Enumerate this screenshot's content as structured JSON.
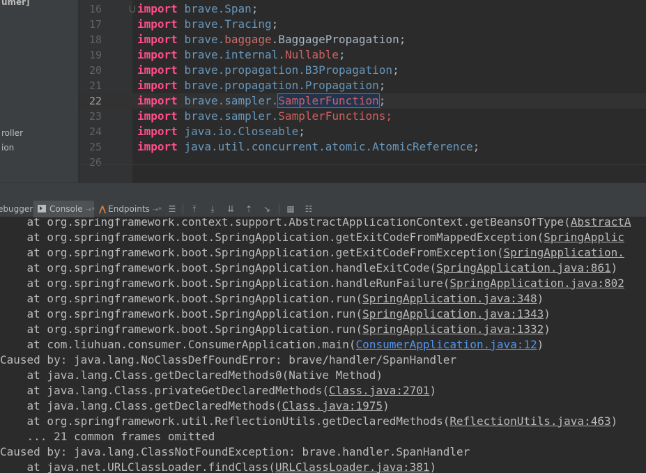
{
  "project_tree": {
    "items": [
      {
        "label": "umer]",
        "bold": true
      },
      {
        "label": "roller",
        "bold": false
      },
      {
        "label": "ion",
        "bold": false
      }
    ]
  },
  "editor": {
    "current_line": "22",
    "lines": [
      {
        "no": "16",
        "kw": "import",
        "parts": [
          {
            "t": "brave.",
            "c": "pkg"
          },
          {
            "t": "Span",
            "c": "pkg"
          },
          {
            "t": ";",
            "c": "cls"
          }
        ]
      },
      {
        "no": "17",
        "kw": "import",
        "parts": [
          {
            "t": "brave.",
            "c": "pkg"
          },
          {
            "t": "Tracing",
            "c": "pkg"
          },
          {
            "t": ";",
            "c": "cls"
          }
        ]
      },
      {
        "no": "18",
        "kw": "import",
        "parts": [
          {
            "t": "brave.",
            "c": "pkg"
          },
          {
            "t": "baggage",
            "c": "dep"
          },
          {
            "t": ".BaggagePropagation;",
            "c": "cls"
          }
        ]
      },
      {
        "no": "19",
        "kw": "import",
        "parts": [
          {
            "t": "brave.internal.",
            "c": "pkg"
          },
          {
            "t": "Nullable",
            "c": "err"
          },
          {
            "t": ";",
            "c": "cls"
          }
        ]
      },
      {
        "no": "20",
        "kw": "import",
        "parts": [
          {
            "t": "brave.propagation.B3Propagation",
            "c": "pkg"
          },
          {
            "t": ";",
            "c": "cls"
          }
        ]
      },
      {
        "no": "21",
        "kw": "import",
        "parts": [
          {
            "t": "brave.propagation.Propagation",
            "c": "pkg"
          },
          {
            "t": ";",
            "c": "cls"
          }
        ]
      },
      {
        "no": "22",
        "kw": "import",
        "parts": [
          {
            "t": "brave.sampler.",
            "c": "pkg"
          },
          {
            "t": "SamplerFunction",
            "c": "err hl"
          },
          {
            "t": ";",
            "c": "cls"
          }
        ]
      },
      {
        "no": "23",
        "kw": "import",
        "parts": [
          {
            "t": "brave.sampler.",
            "c": "pkg"
          },
          {
            "t": "SamplerFunctions",
            "c": "err"
          },
          {
            "t": ";",
            "c": "err"
          }
        ]
      },
      {
        "no": "24",
        "kw": "import",
        "parts": [
          {
            "t": "java.io.Closeable",
            "c": "pkg"
          },
          {
            "t": ";",
            "c": "cls"
          }
        ]
      },
      {
        "no": "25",
        "kw": "import",
        "parts": [
          {
            "t": "java.util.concurrent.atomic.AtomicReference",
            "c": "pkg"
          },
          {
            "t": ";",
            "c": "cls"
          }
        ]
      },
      {
        "no": "26",
        "kw": "",
        "parts": []
      }
    ]
  },
  "toolbar": {
    "debugger_label": "ebugger",
    "console_label": "Console",
    "console_pin": "→*",
    "endpoints_label": "Endpoints",
    "endpoints_pin": "→*",
    "icons": [
      "menu-icon",
      "scroll-up-icon",
      "download-icon",
      "download-all-icon",
      "upload-icon",
      "step-out-icon",
      "table-icon",
      "settings-columns-icon"
    ]
  },
  "console": {
    "lines": [
      {
        "pre": "    at org.springframework.context.support.AbstractApplicationContext.getBeansOfType(",
        "link": "AbstractA",
        "post": ""
      },
      {
        "pre": "    at org.springframework.boot.SpringApplication.getExitCodeFromMappedException(",
        "link": "SpringApplic",
        "post": ""
      },
      {
        "pre": "    at org.springframework.boot.SpringApplication.getExitCodeFromException(",
        "link": "SpringApplication.",
        "post": ""
      },
      {
        "pre": "    at org.springframework.boot.SpringApplication.handleExitCode(",
        "link": "SpringApplication.java:861",
        "post": ")"
      },
      {
        "pre": "    at org.springframework.boot.SpringApplication.handleRunFailure(",
        "link": "SpringApplication.java:802",
        "post": ""
      },
      {
        "pre": "    at org.springframework.boot.SpringApplication.run(",
        "link": "SpringApplication.java:348",
        "post": ")"
      },
      {
        "pre": "    at org.springframework.boot.SpringApplication.run(",
        "link": "SpringApplication.java:1343",
        "post": ")"
      },
      {
        "pre": "    at org.springframework.boot.SpringApplication.run(",
        "link": "SpringApplication.java:1332",
        "post": ")"
      },
      {
        "pre": "    at com.liuhuan.consumer.ConsumerApplication.main(",
        "link": "ConsumerApplication.java:12",
        "post": ")",
        "blue": true
      },
      {
        "pre": "Caused by: java.lang.NoClassDefFoundError: brave/handler/SpanHandler",
        "link": "",
        "post": ""
      },
      {
        "pre": "    at java.lang.Class.getDeclaredMethods0(Native Method)",
        "link": "",
        "post": ""
      },
      {
        "pre": "    at java.lang.Class.privateGetDeclaredMethods(",
        "link": "Class.java:2701",
        "post": ")"
      },
      {
        "pre": "    at java.lang.Class.getDeclaredMethods(",
        "link": "Class.java:1975",
        "post": ")"
      },
      {
        "pre": "    at org.springframework.util.ReflectionUtils.getDeclaredMethods(",
        "link": "ReflectionUtils.java:463",
        "post": ")"
      },
      {
        "pre": "    ... 21 common frames omitted",
        "link": "",
        "post": ""
      },
      {
        "pre": "Caused by: java.lang.ClassNotFoundException: brave.handler.SpanHandler",
        "link": "",
        "post": ""
      },
      {
        "pre": "    at java.net.URLClassLoader.findClass(",
        "link": "URLClassLoader.java:381",
        "post": ")"
      }
    ]
  }
}
